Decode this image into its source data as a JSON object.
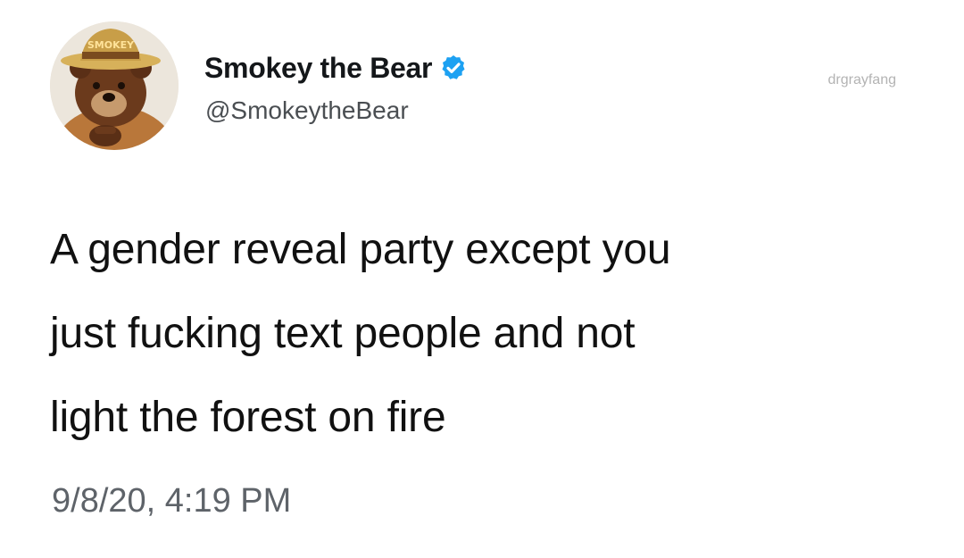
{
  "author": {
    "display_name": "Smokey the Bear",
    "handle": "@SmokeytheBear",
    "verified": true,
    "avatar_icon": "smokey-bear-avatar",
    "avatar_hat_text": "SMOKEY"
  },
  "watermark": "drgrayfang",
  "tweet": {
    "lines": [
      "A gender reveal party except you",
      "just fucking text people and not",
      "light the forest on fire"
    ],
    "timestamp": "9/8/20, 4:19 PM"
  },
  "colors": {
    "verified_badge": "#1da1f2",
    "text": "#111111",
    "secondary_text": "#5e6369"
  }
}
